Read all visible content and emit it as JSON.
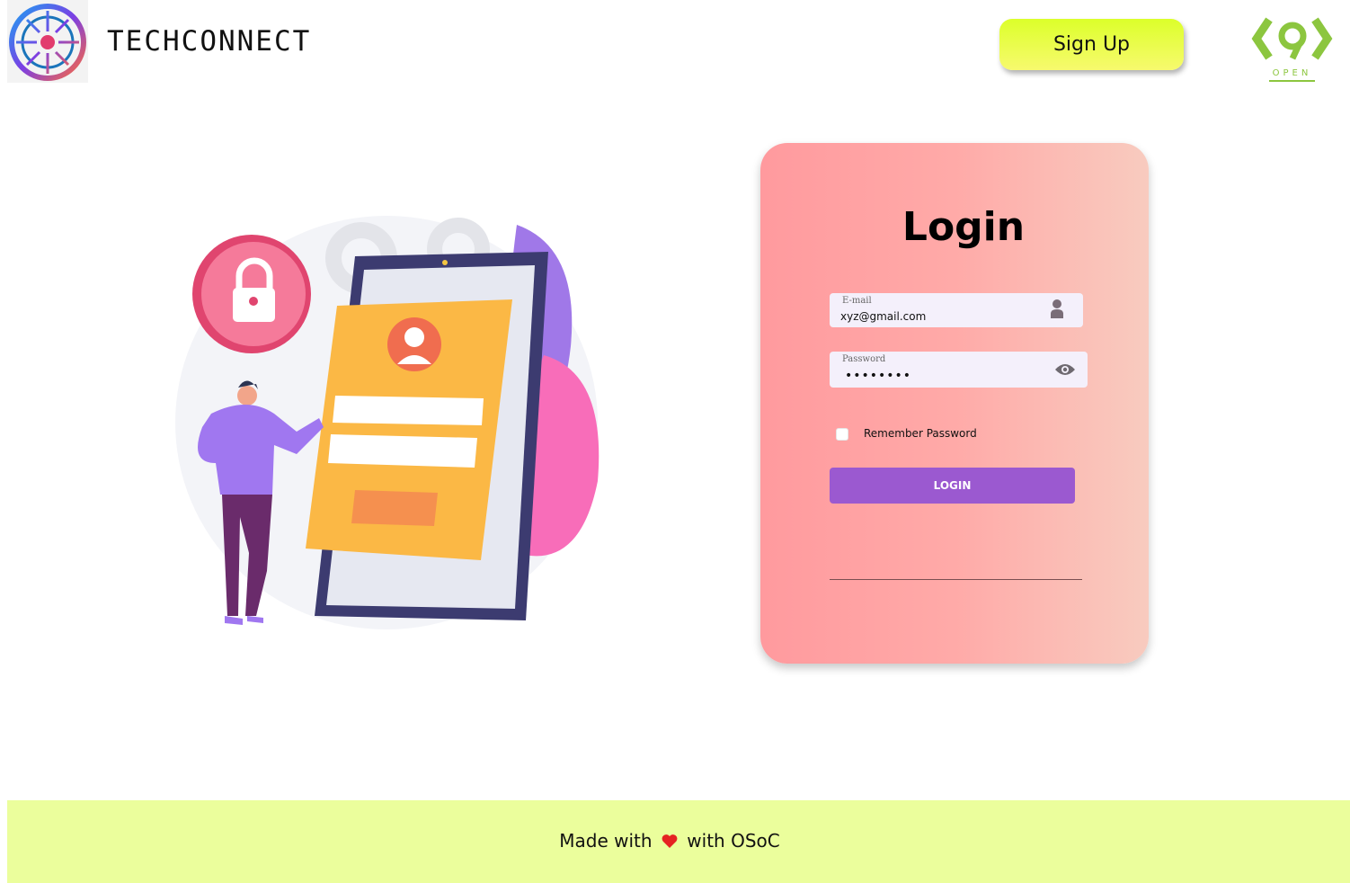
{
  "header": {
    "brand_name": "TECHCONNECT",
    "signup_label": "Sign Up",
    "osoc_logo_text": "OPEN"
  },
  "login": {
    "title": "Login",
    "email_label": "E-mail",
    "email_value": "xyz@gmail.com",
    "password_label": "Password",
    "password_value": "••••••••",
    "remember_label": "Remember Password",
    "login_button_label": "LOGIN"
  },
  "footer": {
    "made_with": "Made with",
    "with_osoc": "with OSoC"
  },
  "colors": {
    "accent": "#9b59d0",
    "signup": "#dcff2a",
    "footer_bg": "#ebfe9c",
    "card_start": "#ff9a9e",
    "card_end": "#f8cbbf",
    "heart": "#e52222"
  },
  "icons": {
    "logo": "circuit-badge-icon",
    "user_field": "person-icon",
    "password_field": "eye-icon",
    "footer": "heart-icon"
  }
}
